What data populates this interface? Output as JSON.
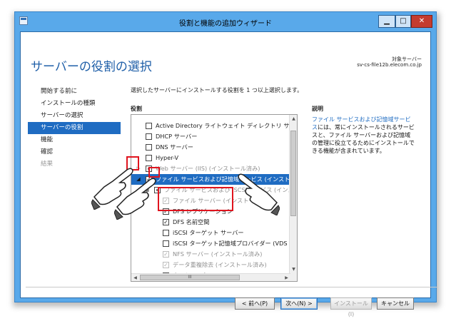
{
  "window": {
    "title": "役割と機能の追加ウィザード",
    "minimize": "▁",
    "maximize": "□",
    "close": "✕"
  },
  "page": {
    "title": "サーバーの役割の選択",
    "destination_label": "対象サーバー",
    "destination_server": "sv-cs-file12b.elecom.co.jp"
  },
  "nav": {
    "items": [
      {
        "label": "開始する前に",
        "state": "normal"
      },
      {
        "label": "インストールの種類",
        "state": "normal"
      },
      {
        "label": "サーバーの選択",
        "state": "normal"
      },
      {
        "label": "サーバーの役割",
        "state": "active"
      },
      {
        "label": "機能",
        "state": "normal"
      },
      {
        "label": "確認",
        "state": "normal"
      },
      {
        "label": "結果",
        "state": "disabled"
      }
    ]
  },
  "main": {
    "intro": "選択したサーバーにインストールする役割を 1 つ以上選択します。",
    "roles_header": "役割",
    "description_header": "説明",
    "description_link": "ファイル サービスおよび記憶域サービス",
    "description_text": "には、常にインストールされるサービスと、ファイル サーバーおよび記憶域の管理に役立てるためにインストールできる機能が含まれています。"
  },
  "roles": [
    {
      "label": "Active Directory ライトウェイト ディレクトリ サービス",
      "indent": 0,
      "expander": "",
      "check": "unchecked",
      "style": "normal"
    },
    {
      "label": "DHCP サーバー",
      "indent": 0,
      "expander": "",
      "check": "unchecked",
      "style": "normal"
    },
    {
      "label": "DNS サーバー",
      "indent": 0,
      "expander": "",
      "check": "unchecked",
      "style": "normal"
    },
    {
      "label": "Hyper-V",
      "indent": 0,
      "expander": "",
      "check": "unchecked",
      "style": "normal"
    },
    {
      "label": "Web サーバー (IIS) (インストール済み)",
      "indent": 0,
      "expander": "▷",
      "check": "partial",
      "style": "gray"
    },
    {
      "label": "ファイル サービスおよび記憶域サービス (インストール済み)",
      "indent": 0,
      "expander": "◢",
      "check": "checked",
      "style": "selected"
    },
    {
      "label": "ファイル サービスおよび iSCSI サービス (インストール済み)",
      "indent": 1,
      "expander": "◢",
      "check": "partial",
      "style": "gray"
    },
    {
      "label": "ファイル サーバー (インストール済み)",
      "indent": 2,
      "expander": "",
      "check": "checked-disabled",
      "style": "gray"
    },
    {
      "label": "DFS レプリケーション",
      "indent": 2,
      "expander": "",
      "check": "checked",
      "style": "normal"
    },
    {
      "label": "DFS 名前空間",
      "indent": 2,
      "expander": "",
      "check": "checked",
      "style": "normal"
    },
    {
      "label": "iSCSI ターゲット サーバー",
      "indent": 2,
      "expander": "",
      "check": "unchecked",
      "style": "normal"
    },
    {
      "label": "iSCSI ターゲット記憶域プロバイダー (VDS およ",
      "indent": 2,
      "expander": "",
      "check": "unchecked",
      "style": "normal"
    },
    {
      "label": "NFS サーバー (インストール済み)",
      "indent": 2,
      "expander": "",
      "check": "checked-disabled",
      "style": "gray"
    },
    {
      "label": "データ重複除去 (インストール済み)",
      "indent": 2,
      "expander": "",
      "check": "checked-disabled",
      "style": "gray"
    },
    {
      "label": "ネットワーク ファイル BranchCache",
      "indent": 2,
      "expander": "",
      "check": "unchecked",
      "style": "normal"
    }
  ],
  "scrollbar": {
    "up": "▲",
    "down": "▼",
    "left": "◀",
    "right": "▶",
    "grip": "III"
  },
  "buttons": {
    "prev": "< 前へ(P)",
    "next": "次へ(N) >",
    "install": "インストール(I)",
    "cancel": "キャンセル"
  },
  "colors": {
    "accent": "#1f6cc2",
    "highlight_box": "#e0141e",
    "frame": "#59a9ea"
  },
  "icons": {
    "app": "server-manager-icon",
    "pointer": "pointing-hand-icon"
  }
}
